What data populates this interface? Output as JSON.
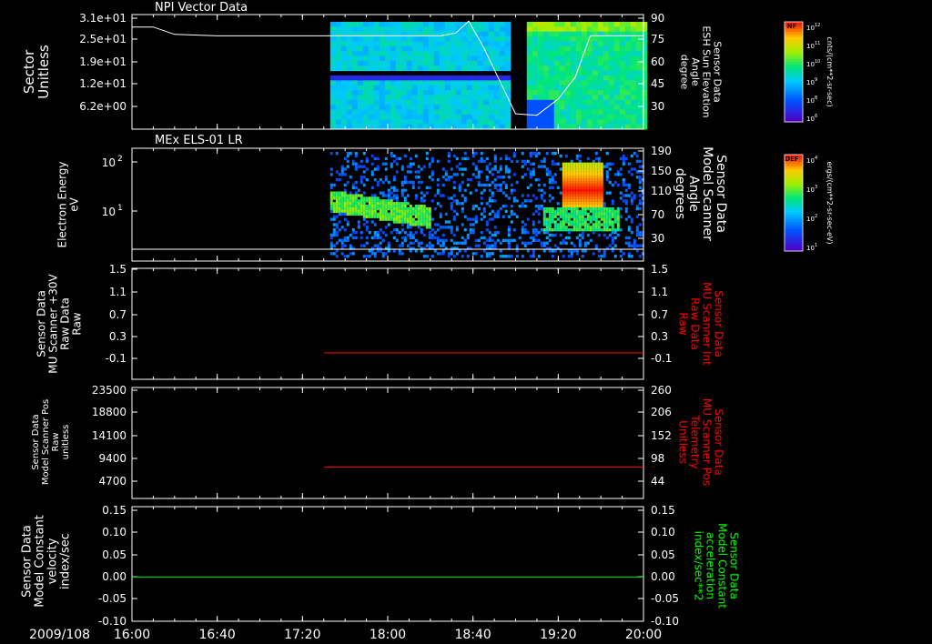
{
  "date_label": "2009/108",
  "time_ticks": [
    "16:00",
    "16:40",
    "17:20",
    "18:00",
    "18:40",
    "19:20",
    "20:00"
  ],
  "colors": {
    "background": "#000000",
    "axis": "#ffffff",
    "red_trace": "#ff0000",
    "green_trace": "#00ff00",
    "white_trace": "#ffffff"
  },
  "colorbars": [
    {
      "badge": "NF",
      "top_label": "10",
      "top_exp": "12",
      "mid_exps": [
        "11",
        "10",
        "9",
        "8"
      ],
      "bottom_label": "10",
      "bottom_exp": "6",
      "unit": "cnts/(cm**2-sr-sec)"
    },
    {
      "badge": "DEF",
      "top_label": "10",
      "top_exp": "4",
      "mid_exps": [
        "3",
        "2"
      ],
      "bottom_label": "10",
      "bottom_exp": "1",
      "unit": "ergs/(cm**2-sr-sec-eV)"
    }
  ],
  "chart_data": [
    {
      "type": "heatmap",
      "title": "NPI Vector Data",
      "ylabel": [
        "Sector",
        "Unitless"
      ],
      "yticks": [
        "3.1e+01",
        "2.5e+01",
        "1.9e+01",
        "1.2e+01",
        "6.2e+00"
      ],
      "y2label": [
        "Sensor Data",
        "ESH Sun Elevation",
        "Angle",
        "degree"
      ],
      "y2ticks": [
        "90",
        "75",
        "60",
        "45",
        "30"
      ],
      "y2lim": [
        15,
        90
      ],
      "data_start": "17:33",
      "data_gap": [
        "19:00",
        "19:05"
      ],
      "overlay_line": {
        "name": "ESH Sun Elevation Angle",
        "x": [
          "16:00",
          "16:10",
          "16:20",
          "16:40",
          "17:20",
          "18:00",
          "18:25",
          "18:32",
          "18:38",
          "18:45",
          "18:55",
          "19:00",
          "19:10",
          "19:20",
          "19:28",
          "19:35",
          "20:00"
        ],
        "y": [
          84,
          84,
          79,
          78,
          78,
          78,
          78,
          80,
          88,
          70,
          40,
          25,
          24,
          35,
          50,
          78,
          78
        ]
      }
    },
    {
      "type": "heatmap",
      "title": "MEx ELS-01 LR",
      "ylabel": [
        "Electron Energy",
        "eV"
      ],
      "yticks": [
        "10",
        "10"
      ],
      "ytick_exps": [
        "2",
        "1"
      ],
      "y2label": [
        "Sensor Data",
        "Model Scanner",
        "Angle",
        "degrees"
      ],
      "y2ticks": [
        "190",
        "150",
        "110",
        "70",
        "30"
      ],
      "y2lim": [
        10,
        190
      ],
      "data_start": "17:33",
      "overlay_line": {
        "name": "Model Scanner Angle",
        "x": [
          "16:00",
          "20:00"
        ],
        "y": [
          10,
          10
        ]
      }
    },
    {
      "type": "line",
      "ylabel": [
        "Sensor Data",
        "MU Scanner +30V",
        "Raw Data",
        "Raw"
      ],
      "yticks": [
        "1.5",
        "1.1",
        "0.7",
        "0.3",
        "-0.1"
      ],
      "ylim": [
        -0.3,
        1.5
      ],
      "y2label": [
        "Sensor Data",
        "MU Scanner Int",
        "Raw Data",
        "Raw"
      ],
      "y2ticks": [
        "1.5",
        "1.1",
        "0.7",
        "0.3",
        "-0.1"
      ],
      "series": [
        {
          "x": [
            "17:30",
            "20:00"
          ],
          "y": [
            0.0,
            0.0
          ],
          "color": "#ff0000"
        }
      ]
    },
    {
      "type": "line",
      "ylabel": [
        "Sensor Data",
        "Model Scanner Pos",
        "Raw",
        "unitless"
      ],
      "yticks": [
        "23500",
        "18800",
        "14100",
        "9400",
        "4700"
      ],
      "ylim": [
        0,
        23500
      ],
      "y2label": [
        "Sensor Data",
        "MU Scanner Pos",
        "Telemetry",
        "Unitless"
      ],
      "y2ticks": [
        "260",
        "206",
        "152",
        "98",
        "44"
      ],
      "series": [
        {
          "x": [
            "17:30",
            "20:00"
          ],
          "y": [
            7600,
            7600
          ],
          "color": "#ff0000"
        }
      ]
    },
    {
      "type": "line",
      "ylabel": [
        "Sensor Data",
        "Model Constant",
        "velocity",
        "index/sec"
      ],
      "yticks": [
        "0.15",
        "0.10",
        "0.05",
        "0.00",
        "-0.05",
        "-0.10"
      ],
      "ylim": [
        -0.1,
        0.15
      ],
      "y2label": [
        "Sensor Data",
        "Model Constant",
        "acceleration",
        "index/sec**2"
      ],
      "y2ticks": [
        "0.15",
        "0.10",
        "0.05",
        "0.00",
        "-0.05",
        "-0.10"
      ],
      "series": [
        {
          "x": [
            "16:00",
            "20:00"
          ],
          "y": [
            0.0,
            0.0
          ],
          "color": "#00ff00"
        }
      ]
    }
  ]
}
